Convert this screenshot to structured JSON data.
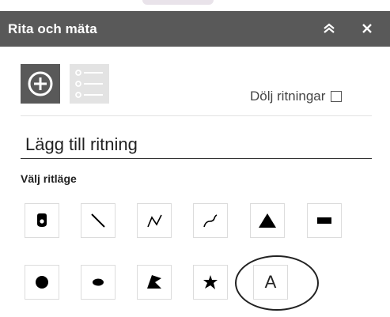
{
  "panel": {
    "title": "Rita och mäta",
    "header_icons": [
      "chevron-double-up-icon",
      "close-icon"
    ]
  },
  "mode_buttons": [
    {
      "name": "add-drawing-mode",
      "icon": "plus-circle-icon",
      "active": true
    },
    {
      "name": "list-drawings-mode",
      "icon": "list-icon",
      "active": false
    }
  ],
  "hide_drawings": {
    "label": "Dölj ritningar",
    "checked": false
  },
  "section": {
    "title": "Lägg till ritning",
    "subtitle": "Välj ritläge"
  },
  "tools": [
    {
      "name": "point",
      "icon": "point-marker-icon"
    },
    {
      "name": "line",
      "icon": "line-icon"
    },
    {
      "name": "polyline",
      "icon": "polyline-icon"
    },
    {
      "name": "freehand-line",
      "icon": "freehand-line-icon"
    },
    {
      "name": "triangle",
      "icon": "triangle-icon"
    },
    {
      "name": "rectangle",
      "icon": "rectangle-icon"
    },
    {
      "name": "circle",
      "icon": "circle-icon"
    },
    {
      "name": "ellipse",
      "icon": "ellipse-icon"
    },
    {
      "name": "polygon",
      "icon": "polygon-icon"
    },
    {
      "name": "freehand-polygon",
      "icon": "freehand-polygon-icon"
    },
    {
      "name": "text",
      "icon": "text-icon",
      "label": "A"
    }
  ],
  "colors": {
    "header": "#595959",
    "active_button": "#595959",
    "inactive_button": "#e3e3e3"
  }
}
